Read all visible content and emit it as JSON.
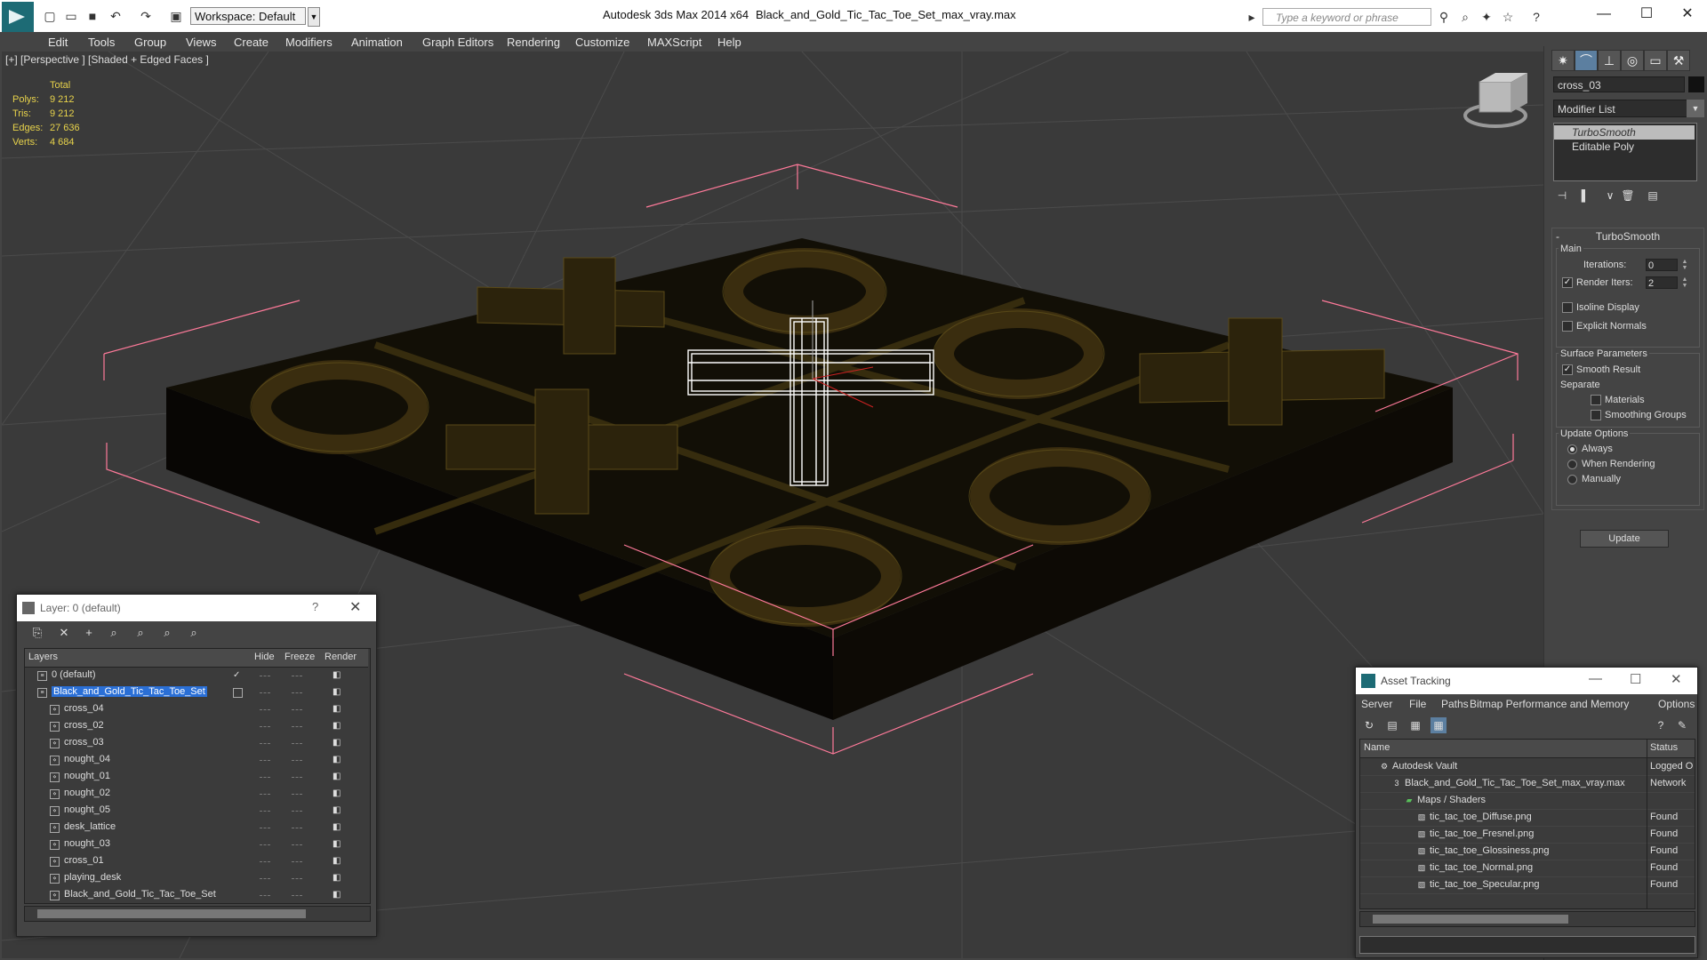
{
  "titlebar": {
    "workspace_label": "Workspace: Default",
    "app_title": "Autodesk 3ds Max  2014 x64",
    "file_title": "Black_and_Gold_Tic_Tac_Toe_Set_max_vray.max",
    "search_placeholder": "Type a keyword or phrase"
  },
  "menu": [
    "Edit",
    "Tools",
    "Group",
    "Views",
    "Create",
    "Modifiers",
    "Animation",
    "Graph Editors",
    "Rendering",
    "Customize",
    "MAXScript",
    "Help"
  ],
  "viewport": {
    "label": "[+] [Perspective ] [Shaded + Edged Faces ]",
    "stats_header": "Total",
    "stats": [
      {
        "label": "Polys:",
        "value": "9 212"
      },
      {
        "label": "Tris:",
        "value": "9 212"
      },
      {
        "label": "Edges:",
        "value": "27 636"
      },
      {
        "label": "Verts:",
        "value": "4 684"
      }
    ]
  },
  "command_panel": {
    "object_name": "cross_03",
    "modifier_list": "Modifier List",
    "stack": [
      "TurboSmooth",
      "Editable Poly"
    ],
    "rollout_title": "TurboSmooth",
    "main_group": "Main",
    "iterations_label": "Iterations:",
    "iterations_value": "0",
    "render_iters_label": "Render Iters:",
    "render_iters_value": "2",
    "isoline_label": "Isoline Display",
    "explicit_normals_label": "Explicit Normals",
    "surface_group": "Surface Parameters",
    "smooth_result_label": "Smooth Result",
    "separate_label": "Separate",
    "materials_label": "Materials",
    "smoothing_groups_label": "Smoothing Groups",
    "update_group": "Update Options",
    "always_label": "Always",
    "when_rendering_label": "When Rendering",
    "manually_label": "Manually",
    "update_button": "Update"
  },
  "layer_window": {
    "title": "Layer: 0 (default)",
    "help": "?",
    "columns": {
      "layers": "Layers",
      "hide": "Hide",
      "freeze": "Freeze",
      "render": "Render"
    },
    "rows": [
      {
        "name": "0 (default)",
        "level": 1
      },
      {
        "name": "Black_and_Gold_Tic_Tac_Toe_Set",
        "level": 1
      },
      {
        "name": "cross_04",
        "level": 2
      },
      {
        "name": "cross_02",
        "level": 2
      },
      {
        "name": "cross_03",
        "level": 2
      },
      {
        "name": "nought_04",
        "level": 2
      },
      {
        "name": "nought_01",
        "level": 2
      },
      {
        "name": "nought_02",
        "level": 2
      },
      {
        "name": "nought_05",
        "level": 2
      },
      {
        "name": "desk_lattice",
        "level": 2
      },
      {
        "name": "nought_03",
        "level": 2
      },
      {
        "name": "cross_01",
        "level": 2
      },
      {
        "name": "playing_desk",
        "level": 2
      },
      {
        "name": "Black_and_Gold_Tic_Tac_Toe_Set",
        "level": 2
      }
    ]
  },
  "asset_window": {
    "title": "Asset Tracking",
    "menus": [
      "Server",
      "File",
      "Paths",
      "Bitmap Performance and Memory",
      "Options"
    ],
    "columns": {
      "name": "Name",
      "status": "Status"
    },
    "rows": [
      {
        "name": "Autodesk Vault",
        "status": "Logged O",
        "level": 0
      },
      {
        "name": "Black_and_Gold_Tic_Tac_Toe_Set_max_vray.max",
        "status": "Network",
        "level": 1
      },
      {
        "name": "Maps / Shaders",
        "status": "",
        "level": 2
      },
      {
        "name": "tic_tac_toe_Diffuse.png",
        "status": "Found",
        "level": 3
      },
      {
        "name": "tic_tac_toe_Fresnel.png",
        "status": "Found",
        "level": 3
      },
      {
        "name": "tic_tac_toe_Glossiness.png",
        "status": "Found",
        "level": 3
      },
      {
        "name": "tic_tac_toe_Normal.png",
        "status": "Found",
        "level": 3
      },
      {
        "name": "tic_tac_toe_Specular.png",
        "status": "Found",
        "level": 3
      }
    ]
  },
  "colors": {
    "selection": "#2a6fd6",
    "stats_text": "#e8d34b",
    "bounding_box": "#ff7a9a",
    "gold_wire": "#6b5a1e"
  }
}
